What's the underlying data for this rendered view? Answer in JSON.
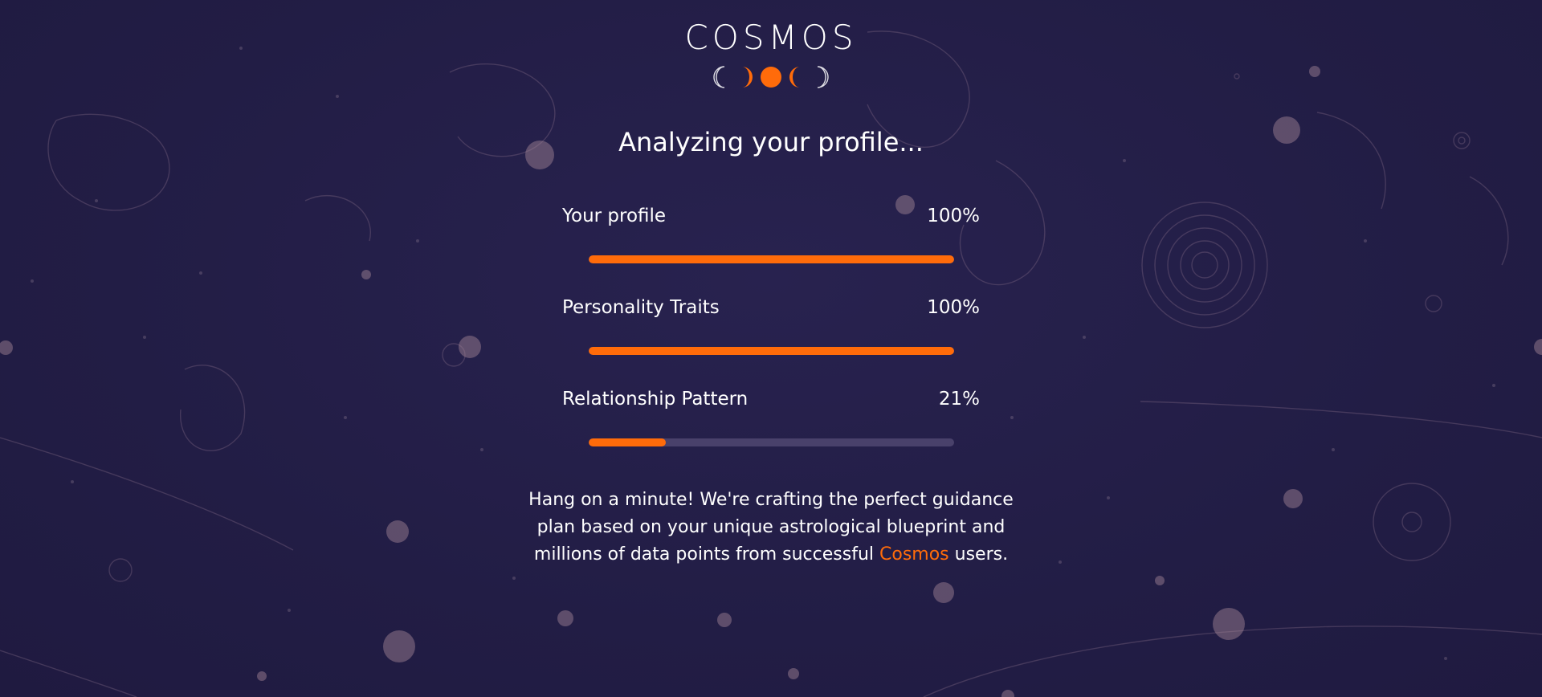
{
  "app": {
    "logo_text": "COSMOS"
  },
  "main": {
    "headline": "Analyzing your profile...",
    "progress": [
      {
        "label": "Your profile",
        "percent_text": "100%",
        "value": 100
      },
      {
        "label": "Personality Traits",
        "percent_text": "100%",
        "value": 100
      },
      {
        "label": "Relationship Pattern",
        "percent_text": "21%",
        "value": 21
      }
    ],
    "message": {
      "before": "Hang on a minute! We're crafting the perfect guidance plan based on your unique astrological blueprint and millions of data points from successful ",
      "brand": "Cosmos",
      "after": " users."
    }
  },
  "colors": {
    "background": "#221d45",
    "accent": "#ff6b0a",
    "text": "#ffffff"
  },
  "icons": {
    "moon_phases": "moon-phases-icon"
  }
}
